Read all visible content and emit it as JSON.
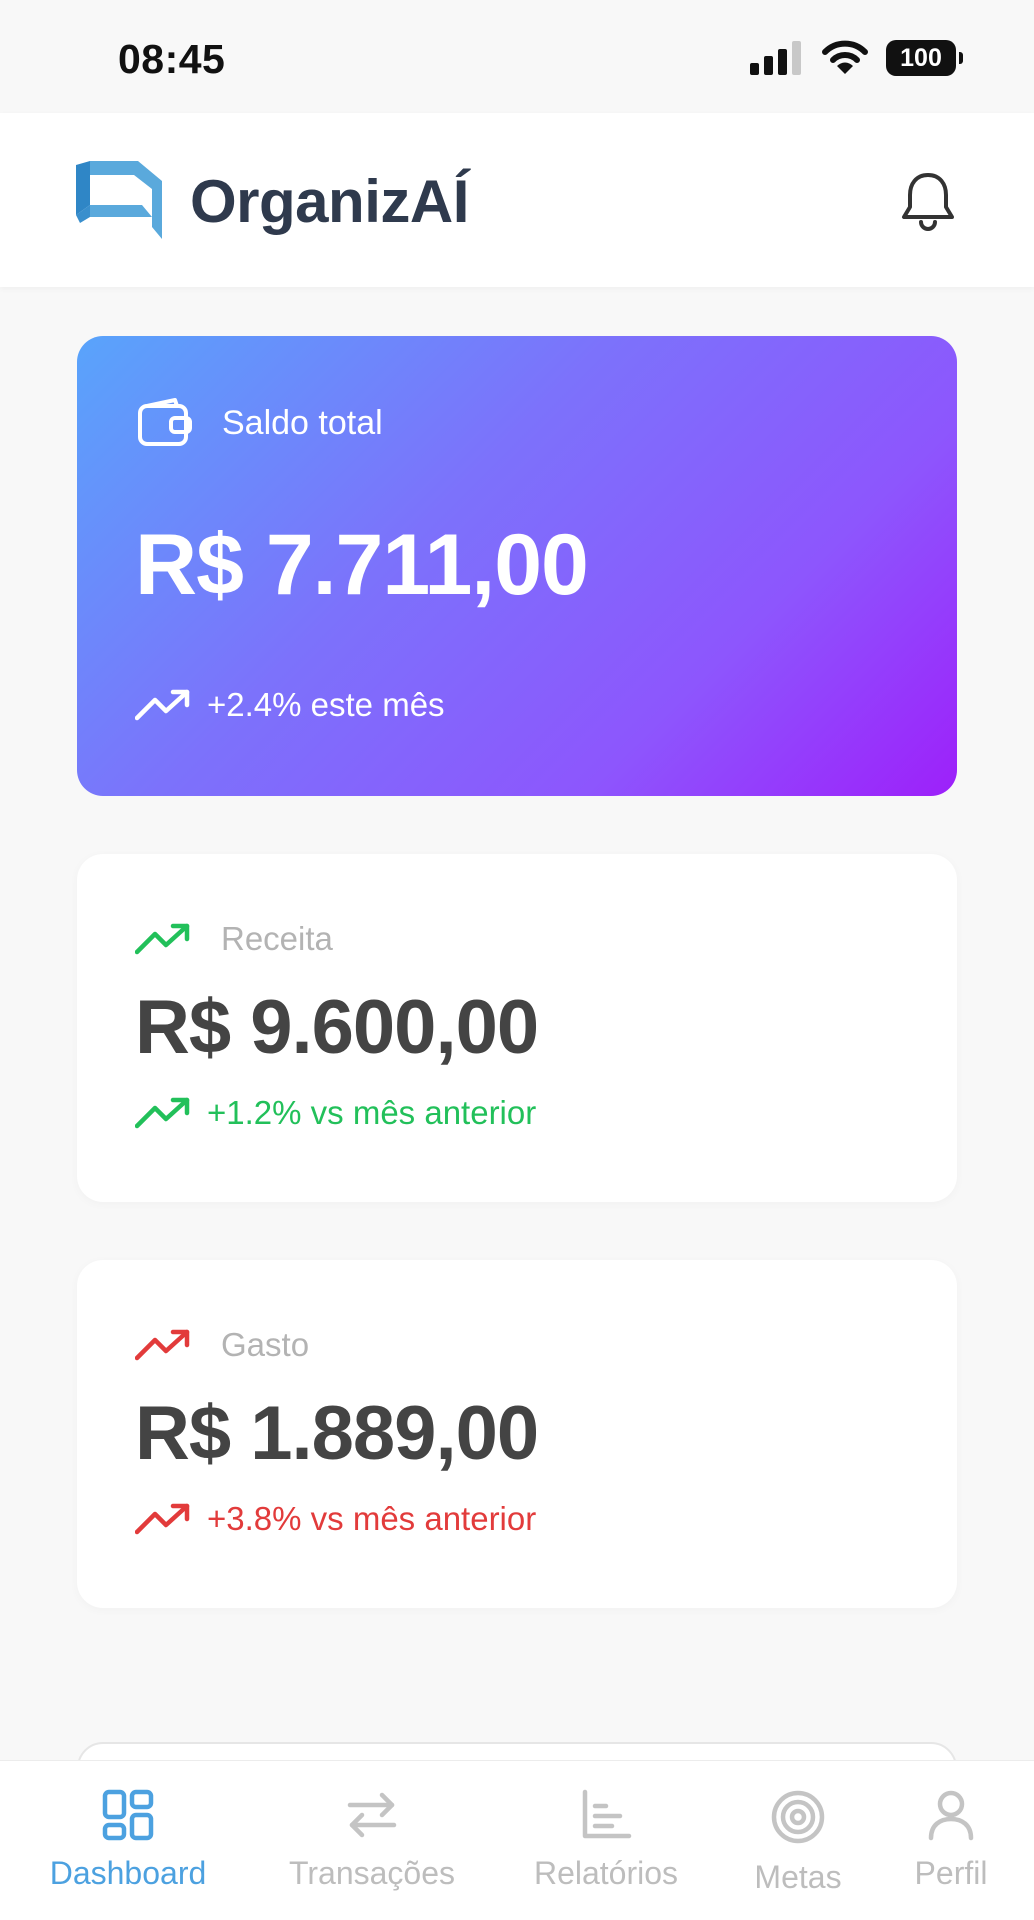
{
  "status_bar": {
    "time": "08:45",
    "battery": "100"
  },
  "header": {
    "title": "OrganizAÍ"
  },
  "balance": {
    "label": "Saldo total",
    "value": "R$ 7.711,00",
    "trend": "+2.4% este mês"
  },
  "income": {
    "label": "Receita",
    "value": "R$ 9.600,00",
    "trend": "+1.2% vs mês anterior"
  },
  "expense": {
    "label": "Gasto",
    "value": "R$ 1.889,00",
    "trend": "+3.8% vs mês anterior"
  },
  "nav": {
    "items": [
      {
        "label": "Dashboard",
        "icon": "dashboard-icon",
        "active": true
      },
      {
        "label": "Transações",
        "icon": "arrows-swap-icon",
        "active": false
      },
      {
        "label": "Relatórios",
        "icon": "bar-chart-icon",
        "active": false
      },
      {
        "label": "Metas",
        "icon": "target-icon",
        "active": false
      },
      {
        "label": "Perfil",
        "icon": "user-icon",
        "active": false
      }
    ]
  },
  "colors": {
    "accent": "#4ca1e0",
    "positive": "#22c05a",
    "negative": "#e23b3b",
    "gradient_start": "#59a4fb",
    "gradient_end": "#9d20fa"
  }
}
